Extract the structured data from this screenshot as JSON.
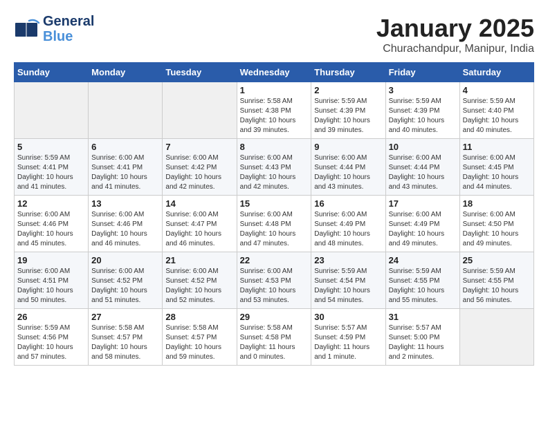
{
  "header": {
    "logo_general": "General",
    "logo_blue": "Blue",
    "month": "January 2025",
    "location": "Churachandpur, Manipur, India"
  },
  "weekdays": [
    "Sunday",
    "Monday",
    "Tuesday",
    "Wednesday",
    "Thursday",
    "Friday",
    "Saturday"
  ],
  "weeks": [
    [
      {
        "day": "",
        "info": ""
      },
      {
        "day": "",
        "info": ""
      },
      {
        "day": "",
        "info": ""
      },
      {
        "day": "1",
        "info": "Sunrise: 5:58 AM\nSunset: 4:38 PM\nDaylight: 10 hours\nand 39 minutes."
      },
      {
        "day": "2",
        "info": "Sunrise: 5:59 AM\nSunset: 4:39 PM\nDaylight: 10 hours\nand 39 minutes."
      },
      {
        "day": "3",
        "info": "Sunrise: 5:59 AM\nSunset: 4:39 PM\nDaylight: 10 hours\nand 40 minutes."
      },
      {
        "day": "4",
        "info": "Sunrise: 5:59 AM\nSunset: 4:40 PM\nDaylight: 10 hours\nand 40 minutes."
      }
    ],
    [
      {
        "day": "5",
        "info": "Sunrise: 5:59 AM\nSunset: 4:41 PM\nDaylight: 10 hours\nand 41 minutes."
      },
      {
        "day": "6",
        "info": "Sunrise: 6:00 AM\nSunset: 4:41 PM\nDaylight: 10 hours\nand 41 minutes."
      },
      {
        "day": "7",
        "info": "Sunrise: 6:00 AM\nSunset: 4:42 PM\nDaylight: 10 hours\nand 42 minutes."
      },
      {
        "day": "8",
        "info": "Sunrise: 6:00 AM\nSunset: 4:43 PM\nDaylight: 10 hours\nand 42 minutes."
      },
      {
        "day": "9",
        "info": "Sunrise: 6:00 AM\nSunset: 4:44 PM\nDaylight: 10 hours\nand 43 minutes."
      },
      {
        "day": "10",
        "info": "Sunrise: 6:00 AM\nSunset: 4:44 PM\nDaylight: 10 hours\nand 43 minutes."
      },
      {
        "day": "11",
        "info": "Sunrise: 6:00 AM\nSunset: 4:45 PM\nDaylight: 10 hours\nand 44 minutes."
      }
    ],
    [
      {
        "day": "12",
        "info": "Sunrise: 6:00 AM\nSunset: 4:46 PM\nDaylight: 10 hours\nand 45 minutes."
      },
      {
        "day": "13",
        "info": "Sunrise: 6:00 AM\nSunset: 4:46 PM\nDaylight: 10 hours\nand 46 minutes."
      },
      {
        "day": "14",
        "info": "Sunrise: 6:00 AM\nSunset: 4:47 PM\nDaylight: 10 hours\nand 46 minutes."
      },
      {
        "day": "15",
        "info": "Sunrise: 6:00 AM\nSunset: 4:48 PM\nDaylight: 10 hours\nand 47 minutes."
      },
      {
        "day": "16",
        "info": "Sunrise: 6:00 AM\nSunset: 4:49 PM\nDaylight: 10 hours\nand 48 minutes."
      },
      {
        "day": "17",
        "info": "Sunrise: 6:00 AM\nSunset: 4:49 PM\nDaylight: 10 hours\nand 49 minutes."
      },
      {
        "day": "18",
        "info": "Sunrise: 6:00 AM\nSunset: 4:50 PM\nDaylight: 10 hours\nand 49 minutes."
      }
    ],
    [
      {
        "day": "19",
        "info": "Sunrise: 6:00 AM\nSunset: 4:51 PM\nDaylight: 10 hours\nand 50 minutes."
      },
      {
        "day": "20",
        "info": "Sunrise: 6:00 AM\nSunset: 4:52 PM\nDaylight: 10 hours\nand 51 minutes."
      },
      {
        "day": "21",
        "info": "Sunrise: 6:00 AM\nSunset: 4:52 PM\nDaylight: 10 hours\nand 52 minutes."
      },
      {
        "day": "22",
        "info": "Sunrise: 6:00 AM\nSunset: 4:53 PM\nDaylight: 10 hours\nand 53 minutes."
      },
      {
        "day": "23",
        "info": "Sunrise: 5:59 AM\nSunset: 4:54 PM\nDaylight: 10 hours\nand 54 minutes."
      },
      {
        "day": "24",
        "info": "Sunrise: 5:59 AM\nSunset: 4:55 PM\nDaylight: 10 hours\nand 55 minutes."
      },
      {
        "day": "25",
        "info": "Sunrise: 5:59 AM\nSunset: 4:55 PM\nDaylight: 10 hours\nand 56 minutes."
      }
    ],
    [
      {
        "day": "26",
        "info": "Sunrise: 5:59 AM\nSunset: 4:56 PM\nDaylight: 10 hours\nand 57 minutes."
      },
      {
        "day": "27",
        "info": "Sunrise: 5:58 AM\nSunset: 4:57 PM\nDaylight: 10 hours\nand 58 minutes."
      },
      {
        "day": "28",
        "info": "Sunrise: 5:58 AM\nSunset: 4:57 PM\nDaylight: 10 hours\nand 59 minutes."
      },
      {
        "day": "29",
        "info": "Sunrise: 5:58 AM\nSunset: 4:58 PM\nDaylight: 11 hours\nand 0 minutes."
      },
      {
        "day": "30",
        "info": "Sunrise: 5:57 AM\nSunset: 4:59 PM\nDaylight: 11 hours\nand 1 minute."
      },
      {
        "day": "31",
        "info": "Sunrise: 5:57 AM\nSunset: 5:00 PM\nDaylight: 11 hours\nand 2 minutes."
      },
      {
        "day": "",
        "info": ""
      }
    ]
  ]
}
